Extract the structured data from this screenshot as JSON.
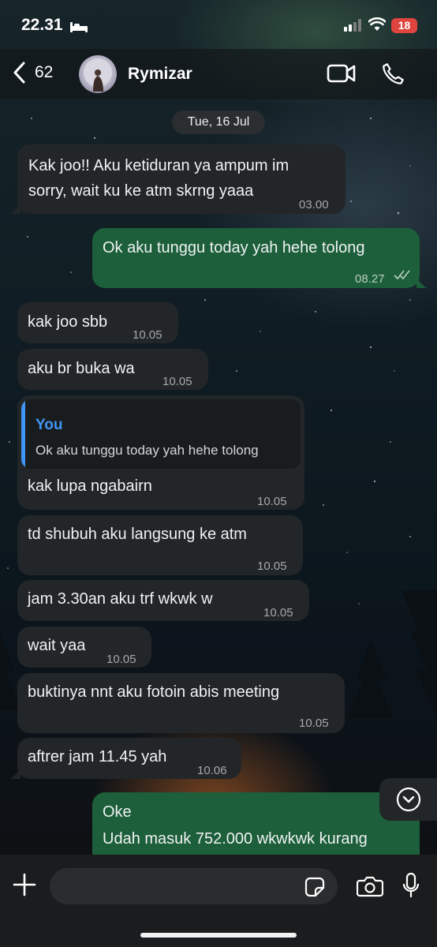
{
  "status_bar": {
    "time": "22.31",
    "battery": "18"
  },
  "header": {
    "back_count": "62",
    "contact_name": "Rymizar"
  },
  "date_divider": "Tue, 16 Jul",
  "messages": [
    {
      "direction": "in",
      "lines": [
        "Kak joo!! Aku ketiduran ya ampum im",
        "sorry, wait ku ke atm skrng yaaa"
      ],
      "time": "03.00"
    },
    {
      "direction": "out",
      "lines": [
        "Ok aku tunggu today yah hehe tolong"
      ],
      "time": "08.27"
    },
    {
      "direction": "in",
      "lines": [
        "kak joo sbb"
      ],
      "time": "10.05"
    },
    {
      "direction": "in",
      "lines": [
        "aku br buka wa"
      ],
      "time": "10.05"
    },
    {
      "direction": "in",
      "reply": {
        "author": "You",
        "text": "Ok aku tunggu today yah hehe tolong"
      },
      "lines": [
        "kak lupa ngabairn"
      ],
      "time": "10.05"
    },
    {
      "direction": "in",
      "lines": [
        "td shubuh aku langsung ke atm"
      ],
      "time": "10.05"
    },
    {
      "direction": "in",
      "lines": [
        "jam 3.30an aku trf wkwk w"
      ],
      "time": "10.05"
    },
    {
      "direction": "in",
      "lines": [
        "wait yaa"
      ],
      "time": "10.05"
    },
    {
      "direction": "in",
      "lines": [
        "buktinya nnt aku fotoin abis meeting"
      ],
      "time": "10.05"
    },
    {
      "direction": "in",
      "lines": [
        "aftrer jam 11.45 yah"
      ],
      "time": "10.06"
    },
    {
      "direction": "out",
      "lines": [
        "Oke",
        "Udah masuk 752.000 wkwkwk kurang"
      ]
    }
  ],
  "input": {
    "placeholder": ""
  },
  "icons": {
    "back": "chevron-left-icon",
    "video": "video-camera-icon",
    "call": "phone-icon",
    "scroll": "chevron-down-circle-icon",
    "plus": "plus-icon",
    "sticker": "sticker-icon",
    "camera": "camera-icon",
    "mic": "microphone-icon",
    "read": "double-check-icon"
  },
  "colors": {
    "incoming_bubble": "#232628",
    "outgoing_bubble": "#1c5f3a",
    "reply_accent": "#3f95f4",
    "battery_low": "#e0443e"
  }
}
